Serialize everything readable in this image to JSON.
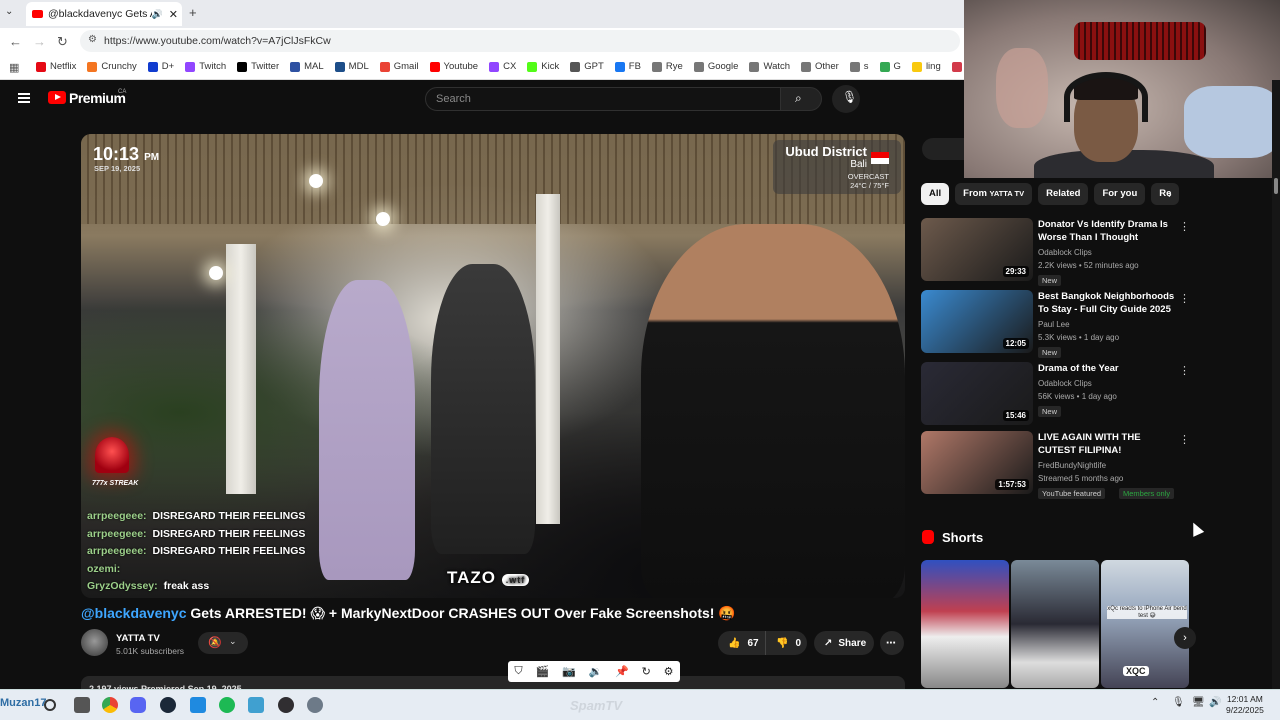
{
  "browser": {
    "tab_title": "@blackdavenyc Gets ARRE",
    "url": "https://www.youtube.com/watch?v=A7jClJsFkCw",
    "bookmarks": [
      {
        "label": "Netflix",
        "color": "#e50914"
      },
      {
        "label": "Crunchy",
        "color": "#f47521"
      },
      {
        "label": "D+",
        "color": "#113ccf"
      },
      {
        "label": "Twitch",
        "color": "#9146ff"
      },
      {
        "label": "Twitter",
        "color": "#000000"
      },
      {
        "label": "MAL",
        "color": "#2e51a2"
      },
      {
        "label": "MDL",
        "color": "#1d4e89"
      },
      {
        "label": "Gmail",
        "color": "#ea4335"
      },
      {
        "label": "Youtube",
        "color": "#ff0000"
      },
      {
        "label": "CX",
        "color": "#9146ff"
      },
      {
        "label": "Kick",
        "color": "#53fc18"
      },
      {
        "label": "GPT",
        "color": "#555555"
      },
      {
        "label": "FB",
        "color": "#1877f2"
      },
      {
        "label": "Rye",
        "color": "#777777"
      },
      {
        "label": "Google",
        "color": "#777777"
      },
      {
        "label": "Watch",
        "color": "#777777"
      },
      {
        "label": "Other",
        "color": "#777777"
      },
      {
        "label": "s",
        "color": "#777777"
      },
      {
        "label": "G",
        "color": "#34a853"
      },
      {
        "label": "ling",
        "color": "#f9c90e"
      },
      {
        "label": "val",
        "color": "#d23a4a"
      }
    ]
  },
  "youtube": {
    "logo_text": "Premium",
    "region": "CA",
    "search_placeholder": "Search"
  },
  "video": {
    "overlay_time": "10:13",
    "overlay_ampm": "PM",
    "overlay_date": "SEP 19, 2025",
    "location": "Ubud District",
    "location_sub": "Bali",
    "weather": "OVERCAST",
    "temperature": "24°C / 75°F",
    "streak": "777x STREAK",
    "chat": [
      {
        "user": "arrpeegeee:",
        "msg": "DISREGARD THEIR FEELINGS"
      },
      {
        "user": "arrpeegeee:",
        "msg": "DISREGARD THEIR FEELINGS"
      },
      {
        "user": "arrpeegeee:",
        "msg": "DISREGARD THEIR FEELINGS"
      },
      {
        "user": "ozemi:",
        "msg": ""
      },
      {
        "user": "GryzOdyssey:",
        "msg": "freak ass"
      }
    ],
    "watermark": "TAZO",
    "watermark_suffix": ".wtf",
    "title_mention": "@blackdavenyc",
    "title_rest": " Gets ARRESTED! 😱 + MarkyNextDoor CRASHES OUT Over Fake Screenshots! 🤬",
    "channel": "YATTA TV",
    "subscribers": "5.01K subscribers",
    "likes": "67",
    "dislikes": "0",
    "share_label": "Share",
    "more_label": "⋯",
    "views_line": "2,197 views  Premiered Sep 19, 2025"
  },
  "sidebar": {
    "chips": [
      {
        "label": "All",
        "sub": ""
      },
      {
        "label": "From ",
        "sub": "YATTA TV"
      },
      {
        "label": "Related",
        "sub": ""
      },
      {
        "label": "For you",
        "sub": ""
      },
      {
        "label": "Re",
        "sub": ""
      }
    ],
    "recommendations": [
      {
        "title": "Donator Vs Identify Drama Is Worse Than I Thought",
        "channel": "Odablock Clips",
        "meta": "2.2K views • 52 minutes ago",
        "badge": "New",
        "duration": "29:33",
        "thumb_color": "#6d5a4c"
      },
      {
        "title": "Best Bangkok Neighborhoods To Stay - Full City Guide 2025",
        "channel": "Paul Lee",
        "meta": "5.3K views • 1 day ago",
        "badge": "New",
        "duration": "12:05",
        "thumb_color": "#3a8ad0"
      },
      {
        "title": "Drama of the Year",
        "channel": "Odablock Clips",
        "meta": "56K views • 1 day ago",
        "badge": "New",
        "duration": "15:46",
        "thumb_color": "#2a2a36"
      },
      {
        "title": "LIVE AGAIN WITH THE CUTEST FILIPINA!",
        "channel": "FredBundyNightlife",
        "meta": "Streamed 5 months ago",
        "badge": "YouTube featured",
        "badge2": "Members only",
        "duration": "1:57:53",
        "thumb_color": "#b07868"
      }
    ],
    "shorts_label": "Shorts",
    "shorts_text": "xQc reacts to iPhone Air bend test 😅",
    "shorts_tag": "XQC",
    "shorts_colors": [
      "#4a6ad0",
      "#6a7a88",
      "#8aa0c0"
    ]
  },
  "taskbar": {
    "username": "Muzan17",
    "time": "12:01 AM",
    "date": "9/22/2025",
    "watermark": "SpamTV"
  }
}
